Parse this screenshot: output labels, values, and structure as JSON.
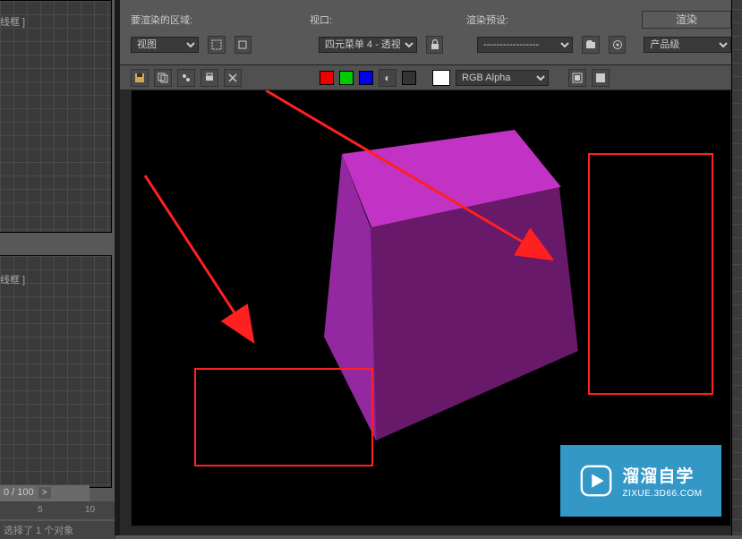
{
  "left": {
    "viewport1_label": "线框 ]",
    "viewport2_label": "线框 ]",
    "time_display": "0 / 100",
    "ruler_5": "5",
    "ruler_10": "10",
    "status": "选择了 1 个对象"
  },
  "toolbar": {
    "region_label": "要渲染的区域:",
    "region_selected": "视图",
    "viewport_label": "视口:",
    "viewport_selected": "四元菜单 4 - 透视",
    "preset_label": "渲染预设:",
    "preset_selected": "-----------------",
    "quality_selected": "产品级",
    "render_btn": "渲染",
    "channel_selected": "RGB Alpha"
  },
  "watermark": {
    "title": "溜溜自学",
    "sub": "ZIXUE.3D66.COM"
  }
}
